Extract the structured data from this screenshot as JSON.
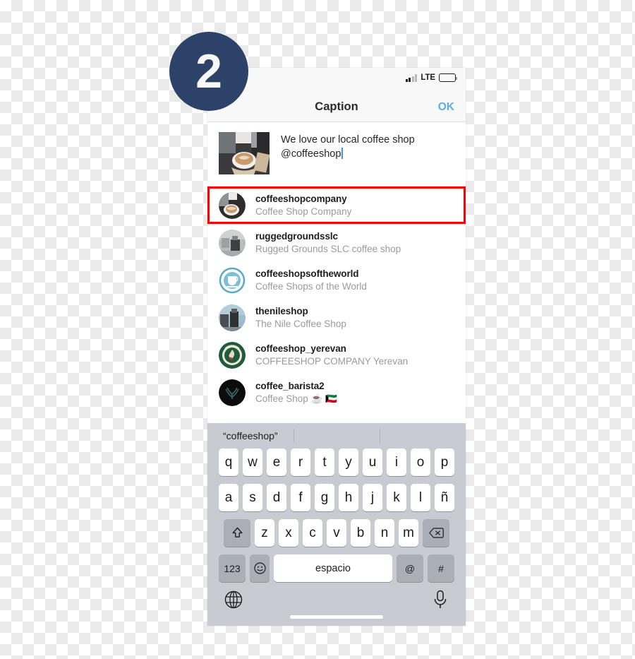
{
  "step_badge": {
    "number": "2"
  },
  "phone": {
    "status_bar": {
      "location_icon": "location-arrow-icon",
      "signal_icon": "signal-bars-icon",
      "network": "LTE",
      "battery_icon": "battery-icon"
    },
    "nav_bar": {
      "title": "Caption",
      "confirm_label": "OK",
      "confirm_color": "#5aaee0"
    },
    "caption": {
      "thumbnail_icon": "post-thumbnail-coffee",
      "text": "We love our local coffee shop @coffeeshop"
    },
    "suggestions": {
      "highlight_color": "#ff0000",
      "items": [
        {
          "username": "coffeeshopcompany",
          "fullname": "Coffee Shop Company",
          "avatar_icon": "avatar-coffeeshopcompany",
          "highlighted": true
        },
        {
          "username": "ruggedgroundsslc",
          "fullname": "Rugged Grounds SLC coffee shop",
          "avatar_icon": "avatar-ruggedgroundsslc",
          "highlighted": false
        },
        {
          "username": "coffeeshopsoftheworld",
          "fullname": "Coffee Shops of the World",
          "avatar_icon": "avatar-coffeeshopsoftheworld",
          "highlighted": false
        },
        {
          "username": "thenileshop",
          "fullname": "The Nile Coffee Shop",
          "avatar_icon": "avatar-thenileshop",
          "highlighted": false
        },
        {
          "username": "coffeeshop_yerevan",
          "fullname": "COFFEESHOP COMPANY Yerevan",
          "avatar_icon": "avatar-coffeeshop-yerevan",
          "highlighted": false
        },
        {
          "username": "coffee_barista2",
          "fullname": "Coffee Shop ☕ 🇰🇼",
          "avatar_icon": "avatar-coffee-barista2",
          "highlighted": false
        }
      ]
    },
    "keyboard": {
      "prediction": "“coffeeshop”",
      "row1": [
        "q",
        "w",
        "e",
        "r",
        "t",
        "y",
        "u",
        "i",
        "o",
        "p"
      ],
      "row2": [
        "a",
        "s",
        "d",
        "f",
        "g",
        "h",
        "j",
        "k",
        "l",
        "ñ"
      ],
      "row3": [
        "z",
        "x",
        "c",
        "v",
        "b",
        "n",
        "m"
      ],
      "shift_icon": "shift-icon",
      "backspace_icon": "backspace-icon",
      "numeric_label": "123",
      "emoji_icon": "emoji-icon",
      "space_label": "espacio",
      "at_label": "@",
      "hash_label": "#",
      "globe_icon": "globe-icon",
      "mic_icon": "microphone-icon"
    }
  }
}
